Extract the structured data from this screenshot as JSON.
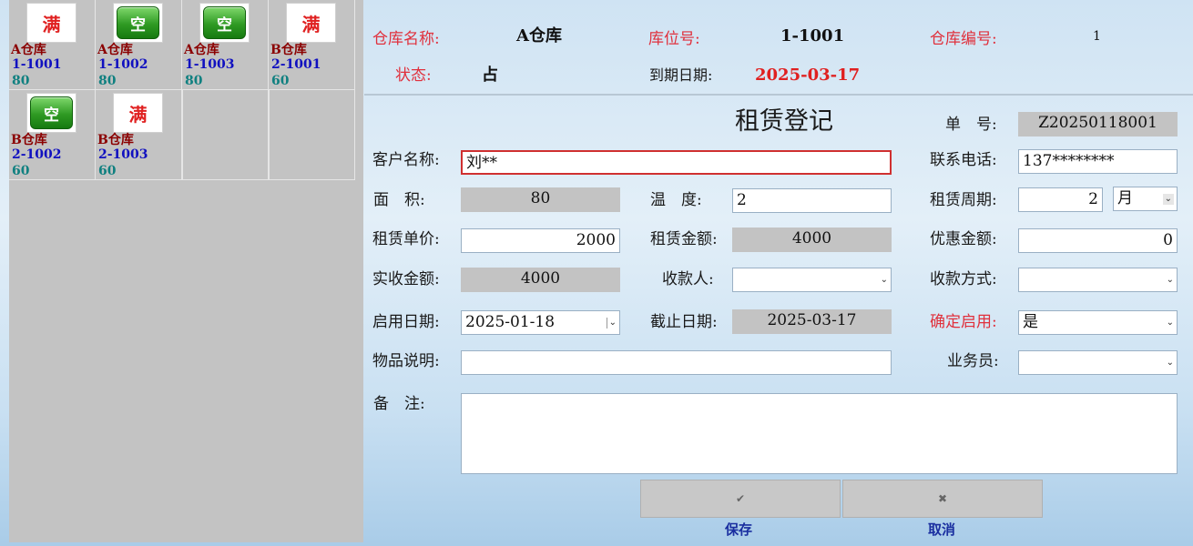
{
  "slots": [
    {
      "status": "满",
      "warehouse": "A仓库",
      "location": "1-1001",
      "area": "80"
    },
    {
      "status": "空",
      "warehouse": "A仓库",
      "location": "1-1002",
      "area": "80"
    },
    {
      "status": "空",
      "warehouse": "A仓库",
      "location": "1-1003",
      "area": "80"
    },
    {
      "status": "满",
      "warehouse": "B仓库",
      "location": "2-1001",
      "area": "60"
    },
    {
      "status": "空",
      "warehouse": "B仓库",
      "location": "2-1002",
      "area": "60"
    },
    {
      "status": "满",
      "warehouse": "B仓库",
      "location": "2-1003",
      "area": "60"
    }
  ],
  "header": {
    "warehouse_name_label": "仓库名称:",
    "warehouse_name": "A仓库",
    "location_no_label": "库位号:",
    "location_no": "1-1001",
    "warehouse_code_label": "仓库编号:",
    "warehouse_code": "1",
    "status_label": "状态:",
    "status": "占",
    "expiry_label": "到期日期:",
    "expiry": "2025-03-17"
  },
  "form": {
    "title": "租赁登记",
    "order_no_label": "单　号:",
    "order_no": "Z20250118001",
    "customer_label": "客户名称:",
    "customer": "刘**",
    "phone_label": "联系电话:",
    "phone": "137********",
    "area_label": "面　积:",
    "area": "80",
    "temp_label": "温　度:",
    "temp": "2",
    "period_label": "租赁周期:",
    "period": "2",
    "period_unit": "月",
    "unit_price_label": "租赁单价:",
    "unit_price": "2000",
    "amount_label": "租赁金额:",
    "amount": "4000",
    "discount_label": "优惠金额:",
    "discount": "0",
    "actual_label": "实收金额:",
    "actual": "4000",
    "payee_label": "收款人:",
    "payee": "",
    "pay_method_label": "收款方式:",
    "pay_method": "",
    "start_label": "启用日期:",
    "start": "2025-01-18",
    "end_label": "截止日期:",
    "end": "2025-03-17",
    "confirm_label": "确定启用:",
    "confirm": "是",
    "goods_label": "物品说明:",
    "goods": "",
    "sales_label": "业务员:",
    "sales": "",
    "remark_label": "备　注:",
    "remark": ""
  },
  "buttons": {
    "save_icon": "✔",
    "save": "保存",
    "cancel_icon": "✖",
    "cancel": "取消"
  },
  "icons": {
    "dropdown": "chevron-down-icon",
    "save": "check-icon",
    "cancel": "close-icon"
  }
}
